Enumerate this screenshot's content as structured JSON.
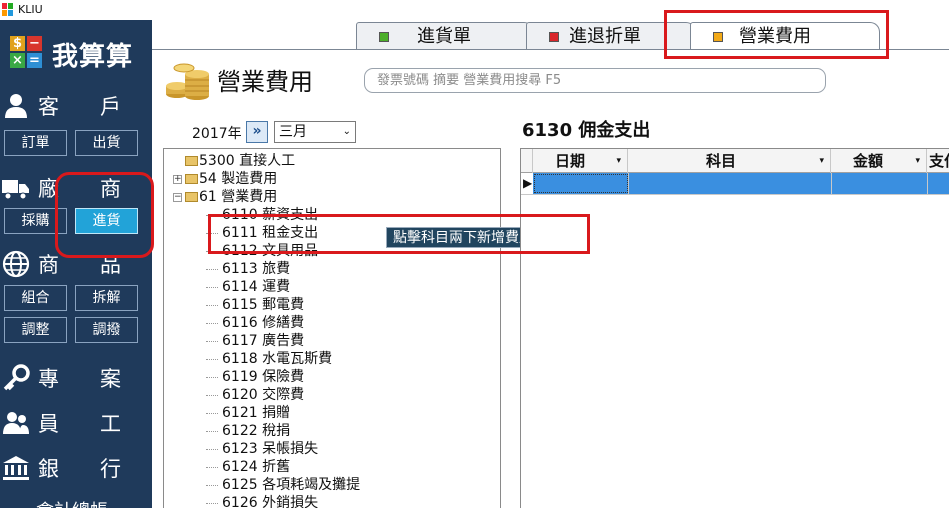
{
  "window": {
    "title": "KLIU"
  },
  "colors": {
    "sidebar": "#1f3a5b",
    "accent": "#22a3d8",
    "annotation": "#d9191c",
    "selection": "#3a8fe0"
  },
  "sidebar": {
    "logo_text": "我算算",
    "logo_symbols": [
      "$",
      "−",
      "×",
      "="
    ],
    "customer": {
      "c1": "客",
      "c2": "戶",
      "icon": "person-icon",
      "buttons": [
        "訂單",
        "出貨"
      ]
    },
    "vendor": {
      "c1": "廠",
      "c2": "商",
      "icon": "truck-icon",
      "buttons": [
        "採購",
        "進貨"
      ]
    },
    "product": {
      "c1": "商",
      "c2": "品",
      "icon": "globe-icon",
      "buttons": [
        "組合",
        "拆解",
        "調整",
        "調撥"
      ]
    },
    "project": {
      "c1": "專",
      "c2": "案",
      "icon": "key-icon"
    },
    "staff": {
      "c1": "員",
      "c2": "工",
      "icon": "people-icon"
    },
    "bank": {
      "c1": "銀",
      "c2": "行",
      "icon": "bank-icon"
    },
    "tail": "會計總帳"
  },
  "tabs": [
    {
      "label": "進貨單",
      "color": "#4caf2a"
    },
    {
      "label": "進退折單",
      "color": "#d9262b"
    },
    {
      "label": "營業費用",
      "color": "#f2a917"
    }
  ],
  "header": {
    "title": "營業費用",
    "search_placeholder": "發票號碼 摘要 營業費用搜尋 F5"
  },
  "filter": {
    "year": "2017年",
    "next_symbol": "»",
    "month": "三月",
    "month_arrow": "⌄"
  },
  "section_title": "6130 佣金支出",
  "tree": {
    "groups": [
      "5300 直接人工",
      "54 製造費用",
      "61 營業費用"
    ],
    "toggles": [
      "+",
      "−"
    ],
    "leaves": [
      "6110 薪資支出",
      "6111 租金支出",
      "6112 文具用品",
      "6113 旅費",
      "6114 運費",
      "6115 郵電費",
      "6116 修繕費",
      "6117 廣告費",
      "6118 水電瓦斯費",
      "6119 保險費",
      "6120 交際費",
      "6121 捐贈",
      "6122 稅捐",
      "6123 呆帳損失",
      "6124 折舊",
      "6125 各項耗竭及攤提",
      "6126 外銷損失"
    ]
  },
  "tooltip": "點擊科目兩下新增費用",
  "grid": {
    "columns": [
      "日期",
      "科目",
      "金額",
      "支付"
    ],
    "sort_glyph": "▾",
    "row_marker": "▶"
  }
}
